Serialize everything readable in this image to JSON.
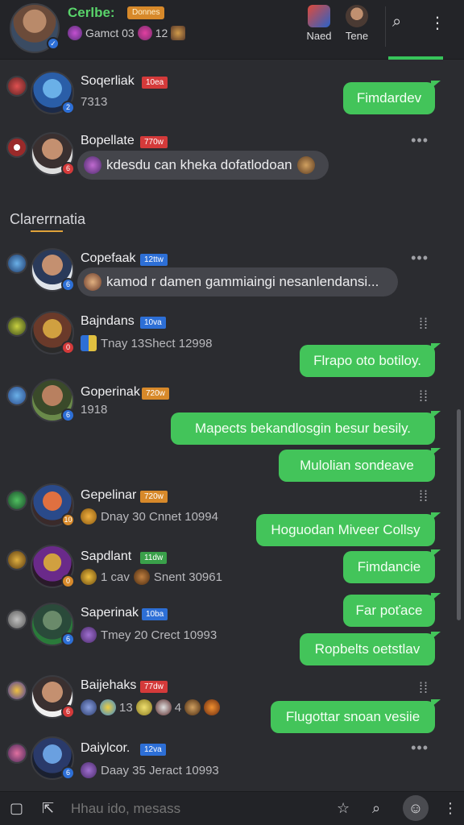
{
  "header": {
    "title": "Cerlbe:",
    "title_tag": "Donnes",
    "sub_text_1": "Gamct 03",
    "sub_text_2": "12",
    "btn_1_label": "Naed",
    "btn_2_label": "Tene"
  },
  "section_title": "Clarerrnatia",
  "rows": [
    {
      "name": "Soqerliak",
      "tag": "10ea",
      "meta": "7313",
      "reply": "Fimdardev"
    },
    {
      "name": "Bopellate",
      "tag": "770w",
      "bubble": "kdesdu can kheka dofatlodoan"
    },
    {
      "name": "Copefaak",
      "tag": "12ttw",
      "bubble": "kamod r damen gammiaingi nesanlendansi..."
    },
    {
      "name": "Bajndans",
      "tag": "10va",
      "meta": "Tnay 13Shect 12998",
      "reply": "Flrapo oto botiloy."
    },
    {
      "name": "Goperinak",
      "tag": "720w",
      "meta": "1918",
      "reply": "Mapects bekandlosgin besur besily.",
      "reply2": "Mulolian sondeave"
    },
    {
      "name": "Gepelinar",
      "tag": "720w",
      "meta": "Dnay 30 Cnnet 10994",
      "reply": "Hoguodan Miveer Collsy"
    },
    {
      "name": "Sapdlant",
      "tag": "11dw",
      "meta_a": "1 cav",
      "meta_b": "Snent 30961",
      "reply": "Fimdancie"
    },
    {
      "name": "Saperinak",
      "tag": "10ba",
      "meta": "Tmey 20 Crect 10993",
      "reply": "Far poťace",
      "reply2": "Ropbelts oetstlav"
    },
    {
      "name": "Baijehaks",
      "tag": "77dw",
      "meta_a": "13",
      "meta_b": "4",
      "reply": "Flugottar snoan vesiie"
    },
    {
      "name": "Daiylcor.",
      "tag": "12va",
      "meta": "Daay 35 Jeract 10993"
    }
  ],
  "bottombar": {
    "placeholder": "Hhau ido, mesass"
  },
  "colors": {
    "accent_green": "#43c45a",
    "background": "#2b2c30",
    "title_green": "#59d36a"
  }
}
